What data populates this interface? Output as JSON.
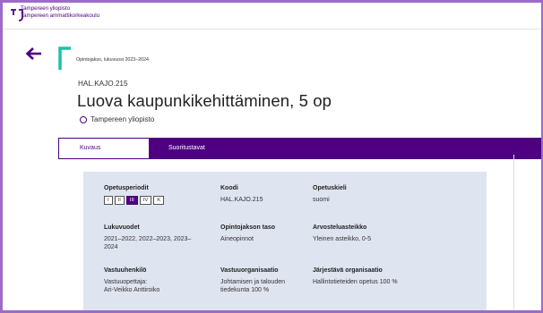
{
  "header": {
    "logo_line1": "Tampereen yliopisto",
    "logo_line2": "Tampereen ammattikorkeakoulu"
  },
  "course": {
    "meta": "Opintojakso, lukuvuosi 2023–2024",
    "code": "HAL.KAJO.215",
    "title": "Luova kaupunkikehittäminen, 5 op",
    "organization": "Tampereen yliopisto"
  },
  "tabs": [
    {
      "label": "Kuvaus",
      "active": true
    },
    {
      "label": "Suoritustavat",
      "active": false
    }
  ],
  "info": {
    "periods": {
      "label": "Opetusperiodit",
      "items": [
        {
          "label": "I",
          "active": false
        },
        {
          "label": "II",
          "active": false
        },
        {
          "label": "III",
          "active": true
        },
        {
          "label": "IV",
          "active": false
        },
        {
          "label": "K",
          "active": false
        }
      ]
    },
    "code": {
      "label": "Koodi",
      "value": "HAL.KAJO.215"
    },
    "language": {
      "label": "Opetuskieli",
      "value": "suomi"
    },
    "years": {
      "label": "Lukuvuodet",
      "value_line1": "2021–2022, 2022–2023, 2023–",
      "value_line2": "2024"
    },
    "level": {
      "label": "Opintojakson taso",
      "value": "Aineopinnot"
    },
    "grading": {
      "label": "Arvosteluasteikko",
      "value": "Yleinen asteikko, 0-5"
    },
    "responsible": {
      "label": "Vastuuhenkilö",
      "value_line1": "Vastuuopettaja:",
      "value_line2": "Ari-Veikko Anttiroiko"
    },
    "resp_org": {
      "label": "Vastuuorganisaatio",
      "value_line1": "Johtamisen ja talouden",
      "value_line2": "tiedekunta 100 %"
    },
    "org": {
      "label": "Järjestävä organisaatio",
      "value": "Hallintotieteiden opetus 100 %"
    }
  },
  "colors": {
    "brand": "#4e0081",
    "accent": "#1fbfa6",
    "frame": "#9b6bc9",
    "info_bg": "#dfe4f1"
  }
}
